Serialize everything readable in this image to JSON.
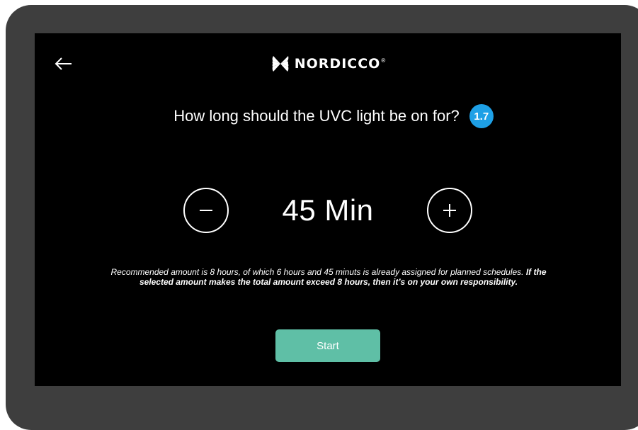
{
  "brand": {
    "name": "NORDICCO",
    "registered_mark": "®"
  },
  "header": {
    "back_icon": "arrow-left-icon"
  },
  "question": {
    "text": "How long should the UVC light be on for?",
    "step_badge": "1.7"
  },
  "stepper": {
    "decrement_icon": "minus-icon",
    "increment_icon": "plus-icon",
    "value": "45 Min"
  },
  "info": {
    "normal_text": "Recommended amount is 8 hours, of which 6 hours and 45 minuts is already assigned for planned schedules.",
    "bold_text": "If the selected amount makes the total amount exceed 8 hours, then it’s on your own responsibility."
  },
  "actions": {
    "start_label": "Start"
  },
  "colors": {
    "bezel": "#3e3e3e",
    "screen": "#000000",
    "badge": "#1ea0e6",
    "start_button": "#5fbfa6"
  }
}
